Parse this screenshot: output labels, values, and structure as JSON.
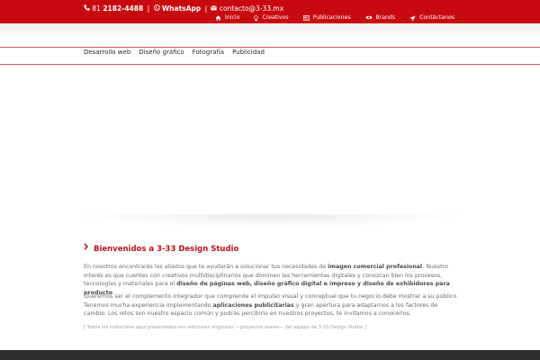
{
  "contact": {
    "phone_prefix": "81",
    "phone_number": "2182-4488",
    "separator": "|",
    "whatsapp_label": "WhatsApp",
    "email": "contacto@3-33.mx"
  },
  "nav": {
    "items": [
      {
        "label": "Inicio",
        "icon": "home-icon"
      },
      {
        "label": "Creativos",
        "icon": "lightbulb-icon"
      },
      {
        "label": "Publicaciones",
        "icon": "newspaper-icon"
      },
      {
        "label": "Brands",
        "icon": "eye-icon"
      },
      {
        "label": "Contáctanos",
        "icon": "paper-plane-icon"
      }
    ]
  },
  "subnav": {
    "items": [
      "Desarrollo web",
      "Diseño gráfico",
      "Fotografía",
      "Publicidad"
    ]
  },
  "welcome": {
    "title": "Bienvenidos a 3-33 Design Studio",
    "p1_a": "En nosotros encontrarás los aliados que te ayudarán a solucionar tus necesidades de ",
    "p1_b": "imagen comercial profesional",
    "p1_c": ". Nuestro interés es que cuentes con creativos multidisciplinarios que dominen las herramientas digitales y conozcan bien los procesos, tecnologías y materiales para el ",
    "p1_d": "diseño de páginas web, diseño gráfico digital e impreso y diseño de exhibidores para producto",
    "p1_e": ".",
    "p2_a": "Queremos ser el complemento integrador que comprende el impulso visual y conceptual que tu negocio debe mostrar a su público. Tenemos mucha experiencia implementando ",
    "p2_b": "aplicaciones publicitarias",
    "p2_c": " y gran apertura para adaptarnos a los factores de cambio. Los retos son nuestro espacio común y podrás percibirlo en nuestros proyectos, te invitamos a conocerlos.",
    "note": "[ Todos los materiales aquí presentados son ediciones originales —proyectos reales— del equipo de 3-33 Design Studio ]"
  },
  "colors": {
    "brand_red": "#c80a10",
    "heading_red": "#b8141a",
    "footer": "#2e2e2e"
  }
}
